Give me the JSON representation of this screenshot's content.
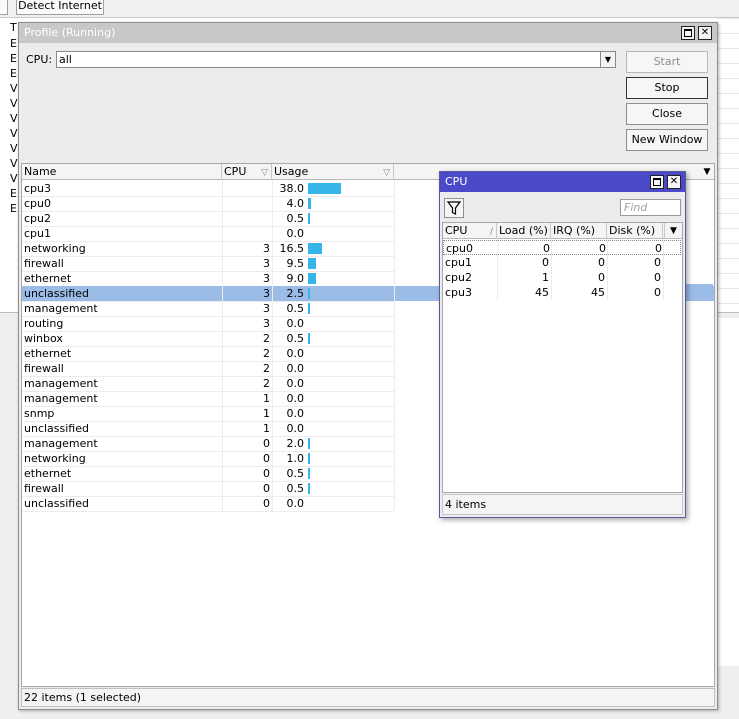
{
  "background": {
    "detect_internet_label": "Detect Internet",
    "row_letters": [
      "T",
      "E",
      "E",
      "E",
      "V",
      "V",
      "V",
      "V",
      "V",
      "V",
      "V",
      "E",
      "E"
    ]
  },
  "profile": {
    "title": "Profile (Running)",
    "cpu_label": "CPU:",
    "cpu_value": "all",
    "buttons": {
      "start": "Start",
      "stop": "Stop",
      "close": "Close",
      "new_window": "New Window"
    },
    "columns": {
      "name": "Name",
      "cpu": "CPU",
      "usage": "Usage"
    },
    "rows": [
      {
        "name": "cpu3",
        "cpu": "",
        "usage": "38.0",
        "usage_value": 38.0
      },
      {
        "name": "cpu0",
        "cpu": "",
        "usage": "4.0",
        "usage_value": 4.0
      },
      {
        "name": "cpu2",
        "cpu": "",
        "usage": "0.5",
        "usage_value": 0.5
      },
      {
        "name": "cpu1",
        "cpu": "",
        "usage": "0.0",
        "usage_value": 0.0
      },
      {
        "name": "networking",
        "cpu": "3",
        "usage": "16.5",
        "usage_value": 16.5
      },
      {
        "name": "firewall",
        "cpu": "3",
        "usage": "9.5",
        "usage_value": 9.5
      },
      {
        "name": "ethernet",
        "cpu": "3",
        "usage": "9.0",
        "usage_value": 9.0
      },
      {
        "name": "unclassified",
        "cpu": "3",
        "usage": "2.5",
        "usage_value": 2.5,
        "selected": true
      },
      {
        "name": "management",
        "cpu": "3",
        "usage": "0.5",
        "usage_value": 0.5
      },
      {
        "name": "routing",
        "cpu": "3",
        "usage": "0.0",
        "usage_value": 0.0
      },
      {
        "name": "winbox",
        "cpu": "2",
        "usage": "0.5",
        "usage_value": 0.5
      },
      {
        "name": "ethernet",
        "cpu": "2",
        "usage": "0.0",
        "usage_value": 0.0
      },
      {
        "name": "firewall",
        "cpu": "2",
        "usage": "0.0",
        "usage_value": 0.0
      },
      {
        "name": "management",
        "cpu": "2",
        "usage": "0.0",
        "usage_value": 0.0
      },
      {
        "name": "management",
        "cpu": "1",
        "usage": "0.0",
        "usage_value": 0.0
      },
      {
        "name": "snmp",
        "cpu": "1",
        "usage": "0.0",
        "usage_value": 0.0
      },
      {
        "name": "unclassified",
        "cpu": "1",
        "usage": "0.0",
        "usage_value": 0.0
      },
      {
        "name": "management",
        "cpu": "0",
        "usage": "2.0",
        "usage_value": 2.0
      },
      {
        "name": "networking",
        "cpu": "0",
        "usage": "1.0",
        "usage_value": 1.0
      },
      {
        "name": "ethernet",
        "cpu": "0",
        "usage": "0.5",
        "usage_value": 0.5
      },
      {
        "name": "firewall",
        "cpu": "0",
        "usage": "0.5",
        "usage_value": 0.5
      },
      {
        "name": "unclassified",
        "cpu": "0",
        "usage": "0.0",
        "usage_value": 0.0
      }
    ],
    "status": "22 items (1 selected)"
  },
  "cpu_window": {
    "title": "CPU",
    "find_placeholder": "Find",
    "columns": {
      "cpu": "CPU",
      "load": "Load (%)",
      "irq": "IRQ (%)",
      "disk": "Disk (%)"
    },
    "rows": [
      {
        "cpu": "cpu0",
        "load": "0",
        "irq": "0",
        "disk": "0"
      },
      {
        "cpu": "cpu1",
        "load": "0",
        "irq": "0",
        "disk": "0"
      },
      {
        "cpu": "cpu2",
        "load": "1",
        "irq": "0",
        "disk": "0"
      },
      {
        "cpu": "cpu3",
        "load": "45",
        "irq": "45",
        "disk": "0"
      }
    ],
    "status": "4 items"
  },
  "colors": {
    "selection": "#9cbce8",
    "usage_bar": "#35b5ea",
    "active_title": "#4a4ac8",
    "inactive_title": "#c8c8c8"
  },
  "icons": {
    "filter": "filter-funnel-icon",
    "close": "close-icon",
    "maximize": "maximize-icon",
    "dropdown": "triangle-down-icon"
  }
}
